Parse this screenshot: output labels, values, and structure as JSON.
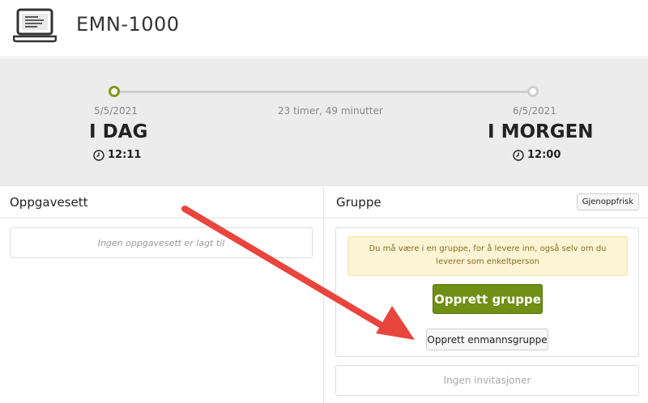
{
  "header": {
    "title": "EMN-1000",
    "icon": "laptop-icon"
  },
  "timeline": {
    "start": {
      "date": "5/5/2021",
      "day": "I DAG",
      "time": "12:11"
    },
    "end": {
      "date": "6/5/2021",
      "day": "I MORGEN",
      "time": "12:00"
    },
    "duration": "23 timer, 49 minutter",
    "accent": "#7d9a1a"
  },
  "left": {
    "title": "Oppgavesett",
    "empty": "Ingen oppgavesett er lagt til"
  },
  "right": {
    "title": "Gruppe",
    "refresh_label": "Gjenoppfrisk",
    "warning": "Du må være i en gruppe, for å levere inn, også selv om du leverer som enkeltperson",
    "create_group_label": "Opprett gruppe",
    "create_solo_label": "Opprett enmannsgruppe",
    "invitations": "Ingen invitasjoner"
  },
  "annotation": {
    "arrow_color": "#e8453c"
  }
}
